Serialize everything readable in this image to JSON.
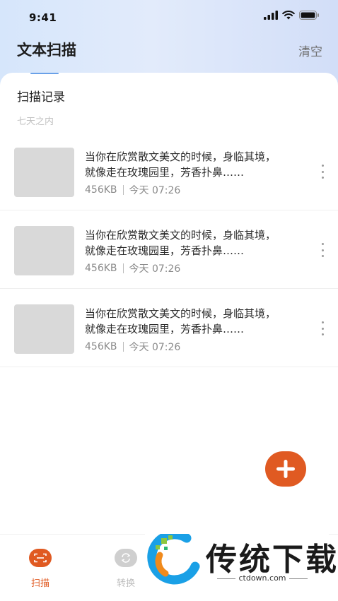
{
  "status_bar": {
    "time": "9:41"
  },
  "header": {
    "title": "文本扫描",
    "clear_label": "清空"
  },
  "section": {
    "title": "扫描记录",
    "subtitle": "七天之内"
  },
  "records": [
    {
      "line1": "当你在欣赏散文美文的时候，身临其境，",
      "line2": "就像走在玫瑰园里，芳香扑鼻……",
      "size": "456KB",
      "time": "今天 07:26"
    },
    {
      "line1": "当你在欣赏散文美文的时候，身临其境，",
      "line2": "就像走在玫瑰园里，芳香扑鼻……",
      "size": "456KB",
      "time": "今天 07:26"
    },
    {
      "line1": "当你在欣赏散文美文的时候，身临其境，",
      "line2": "就像走在玫瑰园里，芳香扑鼻……",
      "size": "456KB",
      "time": "今天 07:26"
    }
  ],
  "tabbar": {
    "tabs": [
      {
        "label": "扫描",
        "icon": "scan-icon",
        "active": true
      },
      {
        "label": "转换",
        "icon": "convert-icon",
        "active": false
      }
    ]
  },
  "watermark": {
    "name": "传统下载",
    "url": "ctdown.com"
  },
  "colors": {
    "accent": "#e05a22",
    "tab_inactive": "#cfcfcf",
    "indicator": "#6aa1e8"
  }
}
